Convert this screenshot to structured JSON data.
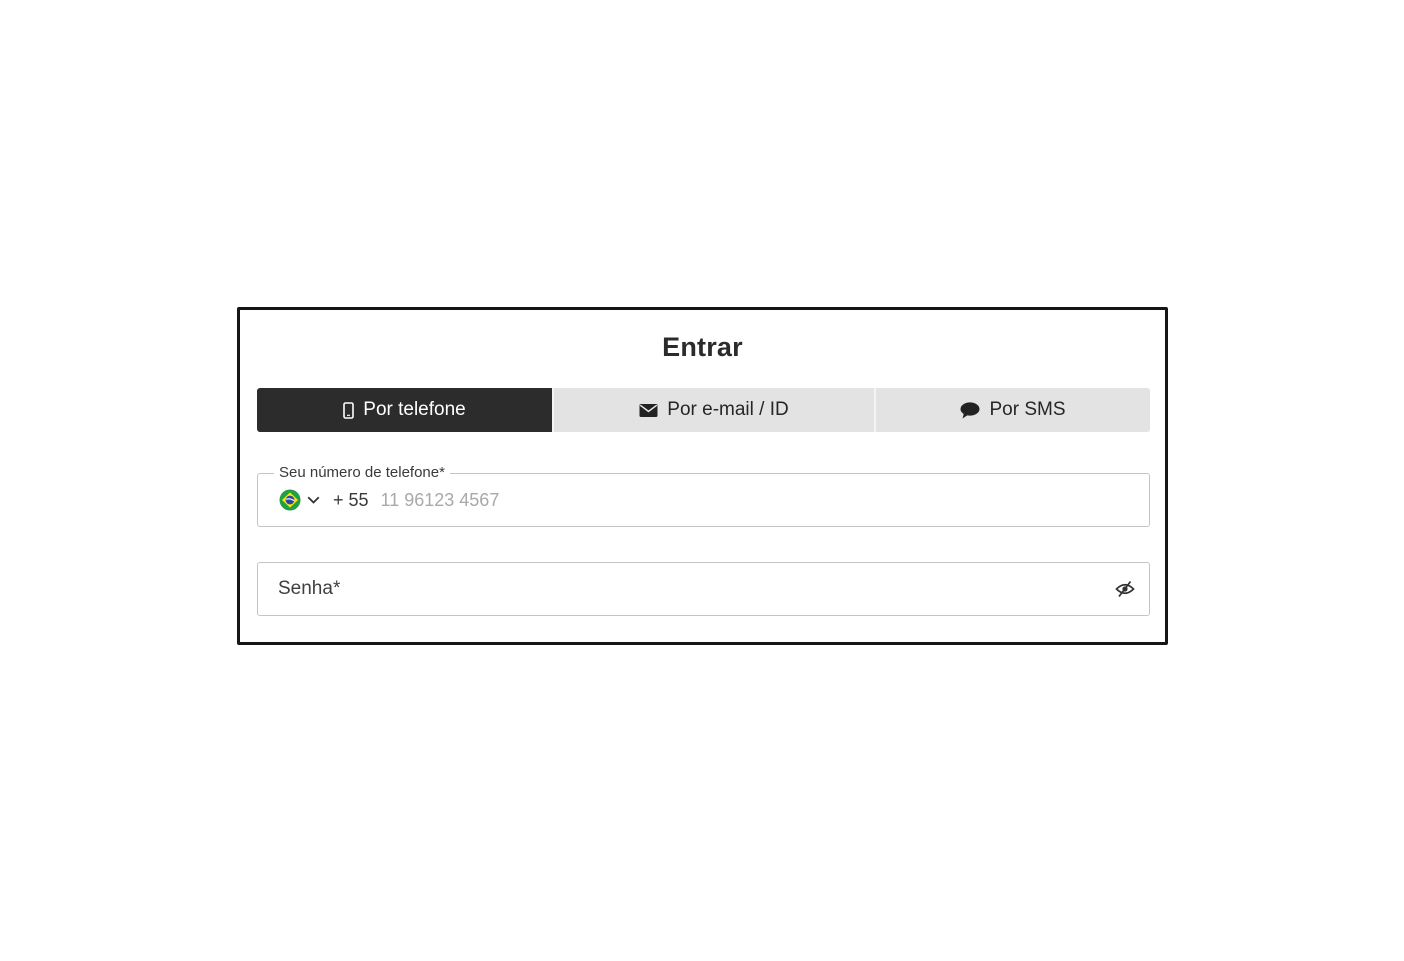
{
  "login": {
    "title": "Entrar",
    "tabs": [
      {
        "label": "Por telefone",
        "icon": "mobile-phone-icon",
        "active": true
      },
      {
        "label": "Por e-mail / ID",
        "icon": "envelope-icon",
        "active": false
      },
      {
        "label": "Por SMS",
        "icon": "chat-bubble-icon",
        "active": false
      }
    ],
    "phone": {
      "label": "Seu número de telefone*",
      "country_flag": "brazil-flag-icon",
      "dial_code": "+ 55",
      "placeholder": "11 96123 4567",
      "value": ""
    },
    "password": {
      "placeholder": "Senha*",
      "value": "",
      "toggle_icon": "eye-slash-icon"
    }
  },
  "colors": {
    "active_tab_bg": "#2c2c2c",
    "inactive_tab_bg": "#e3e3e3",
    "card_border": "#161616",
    "field_border": "#c4c4c4"
  }
}
